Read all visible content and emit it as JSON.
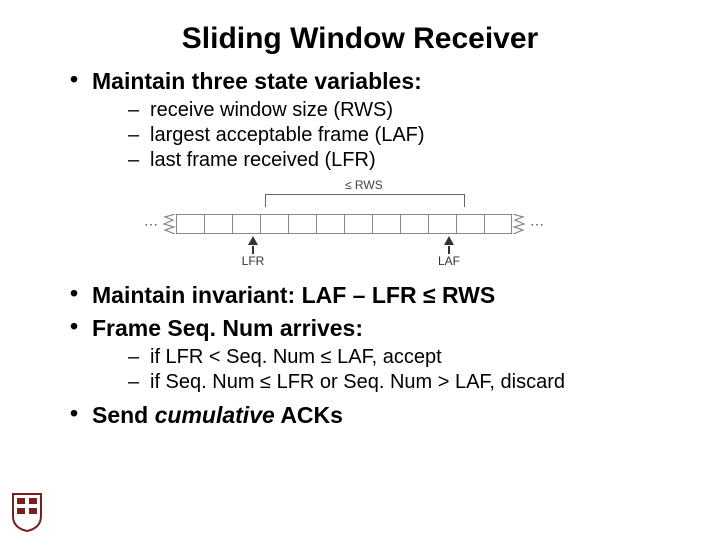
{
  "title": "Sliding Window Receiver",
  "bullets": {
    "b1": "Maintain three state variables:",
    "b1_sub": [
      "receive window size (RWS)",
      "largest acceptable frame (LAF)",
      "last frame received (LFR)"
    ],
    "b2": "Maintain invariant: LAF – LFR ≤ RWS",
    "b3": "Frame Seq. Num arrives:",
    "b3_sub": [
      "if LFR < Seq. Num ≤ LAF, accept",
      "if Seq. Num ≤ LFR or Seq. Num > LAF, discard"
    ],
    "b4_pre": "Send ",
    "b4_em": "cumulative",
    "b4_post": " ACKs"
  },
  "diagram": {
    "ellipsis": "⋯",
    "rws_label": "≤ RWS",
    "lfr_label": "LFR",
    "laf_label": "LAF",
    "cells": 12,
    "lfr_cell_index": 2,
    "laf_cell_index": 9
  }
}
